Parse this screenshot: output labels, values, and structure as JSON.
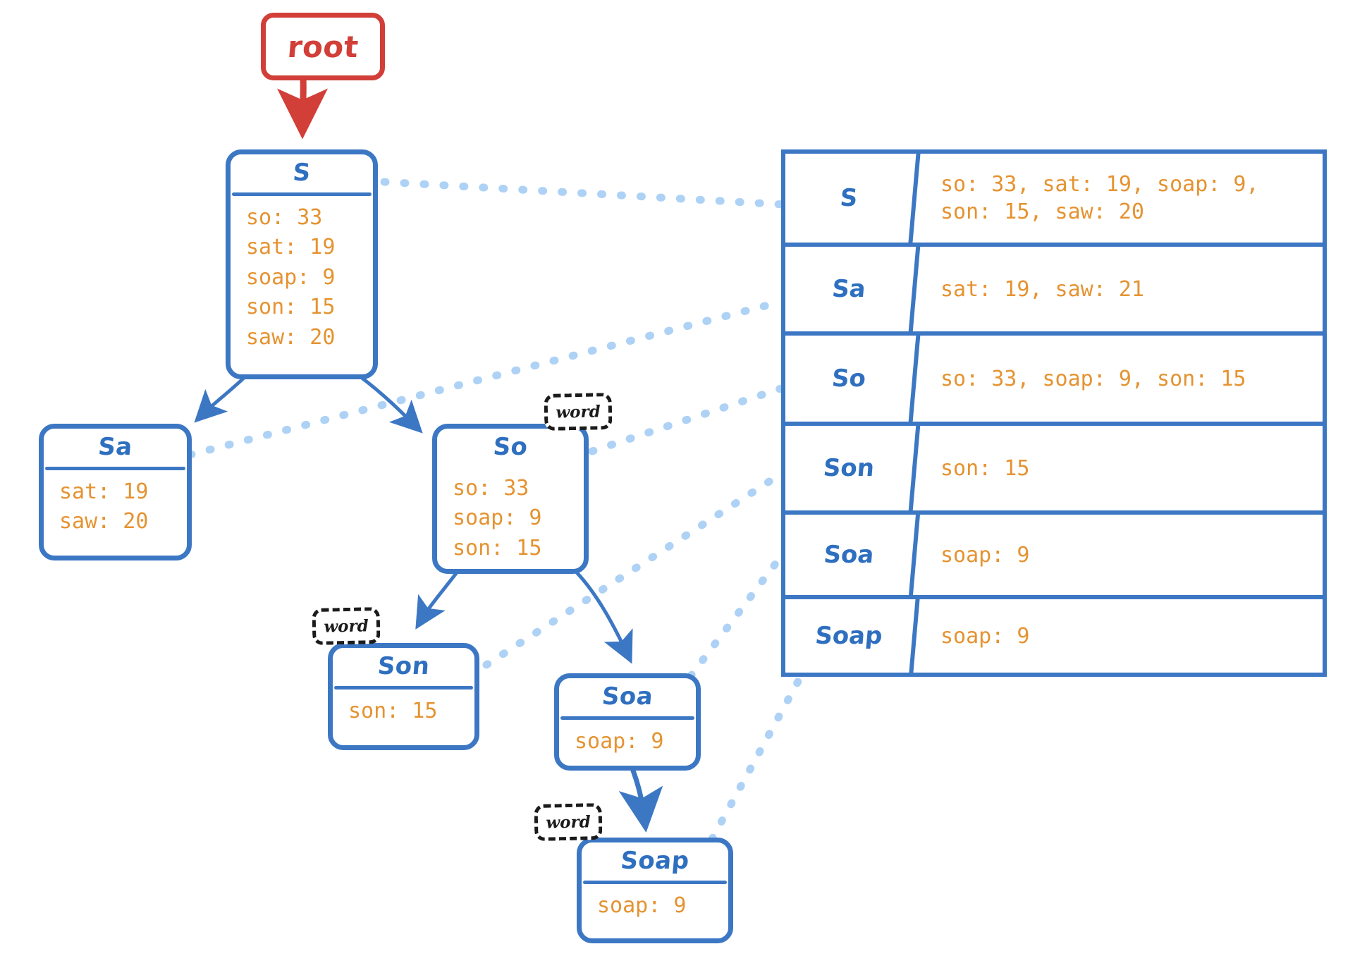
{
  "diagram": {
    "type": "trie-prefix-tree",
    "root": {
      "label": "root"
    },
    "nodes": [
      {
        "id": "S",
        "title": "S",
        "entries": [
          "so: 33",
          "sat: 19",
          "soap: 9",
          "son: 15",
          "saw: 20"
        ],
        "is_word": false
      },
      {
        "id": "Sa",
        "title": "Sa",
        "entries": [
          "sat: 19",
          "saw: 20"
        ],
        "is_word": false
      },
      {
        "id": "So",
        "title": "So",
        "entries": [
          "so: 33",
          "soap: 9",
          "son: 15"
        ],
        "is_word": true,
        "badge": "word"
      },
      {
        "id": "Son",
        "title": "Son",
        "entries": [
          "son: 15"
        ],
        "is_word": true,
        "badge": "word"
      },
      {
        "id": "Soa",
        "title": "Soa",
        "entries": [
          "soap: 9"
        ],
        "is_word": false
      },
      {
        "id": "Soap",
        "title": "Soap",
        "entries": [
          "soap: 9"
        ],
        "is_word": true,
        "badge": "word"
      }
    ],
    "edges": [
      {
        "from": "root",
        "to": "S",
        "style": "solid-red"
      },
      {
        "from": "S",
        "to": "Sa",
        "style": "solid-blue"
      },
      {
        "from": "S",
        "to": "So",
        "style": "solid-blue"
      },
      {
        "from": "So",
        "to": "Son",
        "style": "solid-blue"
      },
      {
        "from": "So",
        "to": "Soa",
        "style": "solid-blue"
      },
      {
        "from": "Soa",
        "to": "Soap",
        "style": "solid-blue"
      }
    ],
    "links_to_table": [
      {
        "node": "S",
        "row": "S"
      },
      {
        "node": "Sa",
        "row": "Sa"
      },
      {
        "node": "So",
        "row": "So"
      },
      {
        "node": "Son",
        "row": "Son"
      },
      {
        "node": "Soa",
        "row": "Soa"
      },
      {
        "node": "Soap",
        "row": "Soap"
      }
    ]
  },
  "table": {
    "rows": [
      {
        "key": "S",
        "value": "so: 33, sat: 19, soap: 9,\nson: 15, saw: 20"
      },
      {
        "key": "Sa",
        "value": "sat: 19, saw: 21"
      },
      {
        "key": "So",
        "value": "so: 33, soap: 9, son: 15"
      },
      {
        "key": "Son",
        "value": "son: 15"
      },
      {
        "key": "Soa",
        "value": "soap: 9"
      },
      {
        "key": "Soap",
        "value": "soap: 9"
      }
    ]
  },
  "colors": {
    "node_border": "#3c77c4",
    "root_border": "#d13f38",
    "title_text": "#2f6fc0",
    "entry_text": "#e59331",
    "dotted_link": "#aed2f5",
    "badge_border": "#1b1b1b",
    "background": "#ffffff"
  }
}
